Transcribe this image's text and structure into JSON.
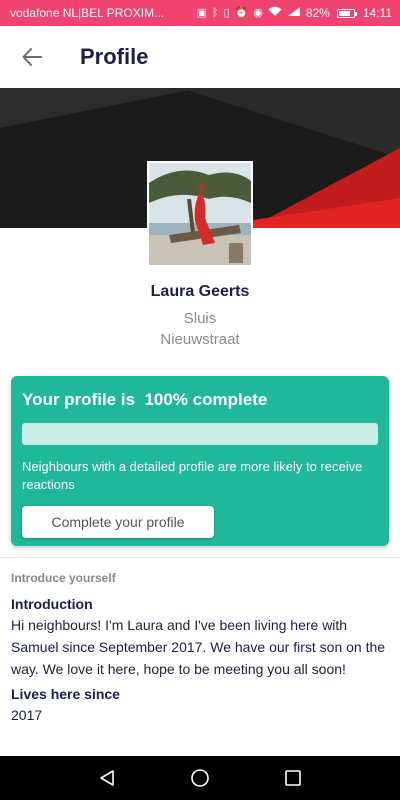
{
  "status_bar": {
    "carrier": "vodafone NL|BEL PROXIM...",
    "battery": "82%",
    "battery_level": 0.82,
    "time": "14:11",
    "background": "#f2436e"
  },
  "app_bar": {
    "title": "Profile",
    "back_icon": "arrow-left-icon"
  },
  "profile": {
    "name": "Laura Geerts",
    "area": "Sluis",
    "street": "Nieuwstraat"
  },
  "completion_card": {
    "title": "Your profile is  100% complete",
    "progress": 1.0,
    "message": "Neighbours with a detailed profile are more likely to receive reactions",
    "button_label": "Complete your profile",
    "color": "#1fb89b"
  },
  "about": {
    "caption": "Introduce yourself",
    "intro_heading": "Introduction",
    "intro_text": "Hi neighbours! I'm Laura and I've been living here with Samuel since September 2017. We have our first son on the way. We love it here, hope to be meeting you all soon!",
    "lives_heading": "Lives here since",
    "lives_value": "2017"
  },
  "nav_bar": {
    "back": "triangle-back-icon",
    "home": "circle-home-icon",
    "recents": "square-recents-icon"
  }
}
